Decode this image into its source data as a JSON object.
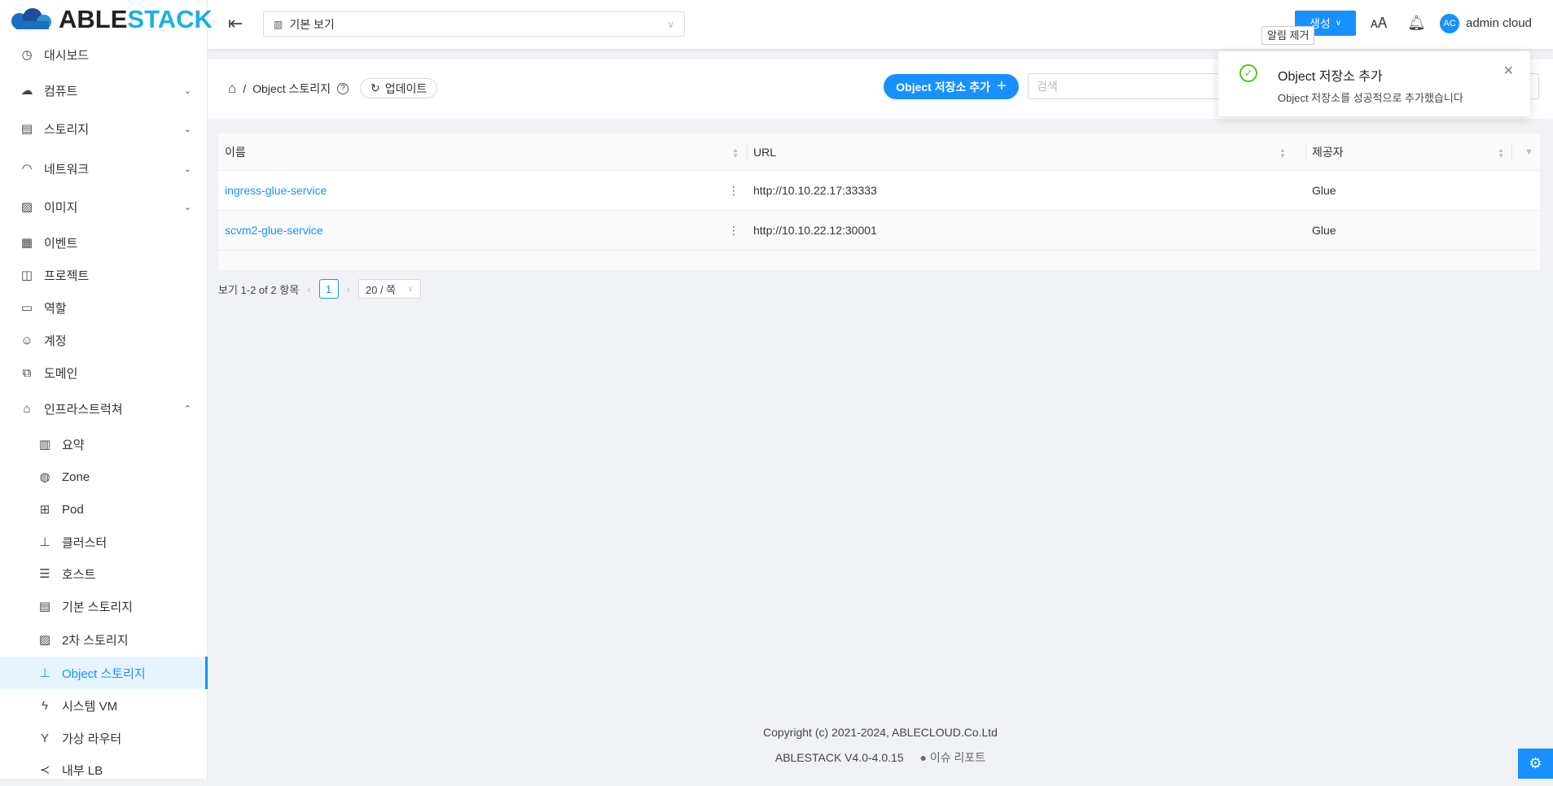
{
  "logo": {
    "part1": "ABLE",
    "part2": "STACK"
  },
  "sidebar": {
    "items": [
      {
        "label": "대시보드",
        "icon": "dashboard-icon",
        "glyph": "◷",
        "level": 0,
        "chev": ""
      },
      {
        "label": "컴퓨트",
        "icon": "cloud-icon",
        "glyph": "☁",
        "level": 0,
        "chev": "⌄"
      },
      {
        "label": "스토리지",
        "icon": "database-icon",
        "glyph": "▤",
        "level": 0,
        "chev": "⌄"
      },
      {
        "label": "네트워크",
        "icon": "wifi-icon",
        "glyph": "◠",
        "level": 0,
        "chev": "⌄"
      },
      {
        "label": "이미지",
        "icon": "picture-icon",
        "glyph": "▨",
        "level": 0,
        "chev": "⌄"
      },
      {
        "label": "이벤트",
        "icon": "schedule-icon",
        "glyph": "▦",
        "level": 0,
        "chev": ""
      },
      {
        "label": "프로젝트",
        "icon": "project-icon",
        "glyph": "◫",
        "level": 0,
        "chev": ""
      },
      {
        "label": "역할",
        "icon": "idcard-icon",
        "glyph": "▭",
        "level": 0,
        "chev": ""
      },
      {
        "label": "계정",
        "icon": "user-icon",
        "glyph": "☺",
        "level": 0,
        "chev": ""
      },
      {
        "label": "도메인",
        "icon": "block-icon",
        "glyph": "⧉",
        "level": 0,
        "chev": ""
      },
      {
        "label": "인프라스트럭쳐",
        "icon": "bank-icon",
        "glyph": "⌂",
        "level": 0,
        "chev": "⌃"
      },
      {
        "label": "요약",
        "icon": "read-icon",
        "glyph": "▥",
        "level": 1,
        "chev": ""
      },
      {
        "label": "Zone",
        "icon": "global-icon",
        "glyph": "◍",
        "level": 1,
        "chev": ""
      },
      {
        "label": "Pod",
        "icon": "appstore-icon",
        "glyph": "⊞",
        "level": 1,
        "chev": ""
      },
      {
        "label": "클러스터",
        "icon": "cluster-icon",
        "glyph": "⊥",
        "level": 1,
        "chev": ""
      },
      {
        "label": "호스트",
        "icon": "host-icon",
        "glyph": "☰",
        "level": 1,
        "chev": ""
      },
      {
        "label": "기본 스토리지",
        "icon": "primary-storage-icon",
        "glyph": "▤",
        "level": 1,
        "chev": ""
      },
      {
        "label": "2차 스토리지",
        "icon": "secondary-storage-icon",
        "glyph": "▨",
        "level": 1,
        "chev": ""
      },
      {
        "label": "Object 스토리지",
        "icon": "object-storage-icon",
        "glyph": "⊥",
        "level": 1,
        "chev": "",
        "active": true
      },
      {
        "label": "시스템 VM",
        "icon": "thunderbolt-icon",
        "glyph": "ϟ",
        "level": 1,
        "chev": ""
      },
      {
        "label": "가상 라우터",
        "icon": "fork-icon",
        "glyph": "Y",
        "level": 1,
        "chev": ""
      },
      {
        "label": "내부 LB",
        "icon": "share-icon",
        "glyph": "≺",
        "level": 1,
        "chev": ""
      }
    ]
  },
  "header": {
    "view": "기본 보기",
    "create": "생성",
    "user_initials": "AC",
    "user_name": "admin cloud",
    "tooltip": "알림 제거"
  },
  "breadcrumb": {
    "current": "Object 스토리지",
    "refresh": "업데이트"
  },
  "actions": {
    "add": "Object 저장소 추가",
    "search_placeholder": "검색"
  },
  "notification": {
    "title": "Object 저장소 추가",
    "message": "Object 저장소를 성공적으로 추가했습니다"
  },
  "table": {
    "columns": [
      "이름",
      "URL",
      "제공자"
    ],
    "rows": [
      {
        "name": "ingress-glue-service",
        "url": "http://10.10.22.17:33333",
        "provider": "Glue"
      },
      {
        "name": "scvm2-glue-service",
        "url": "http://10.10.22.12:30001",
        "provider": "Glue"
      }
    ]
  },
  "pagination": {
    "summary": "보기 1-2 of 2 항목",
    "page": "1",
    "page_size": "20 / 쪽"
  },
  "footer": {
    "copyright": "Copyright (c) 2021-2024, ABLECLOUD.Co.Ltd",
    "version": "ABLESTACK V4.0-4.0.15",
    "issue": "이슈 리포트"
  }
}
